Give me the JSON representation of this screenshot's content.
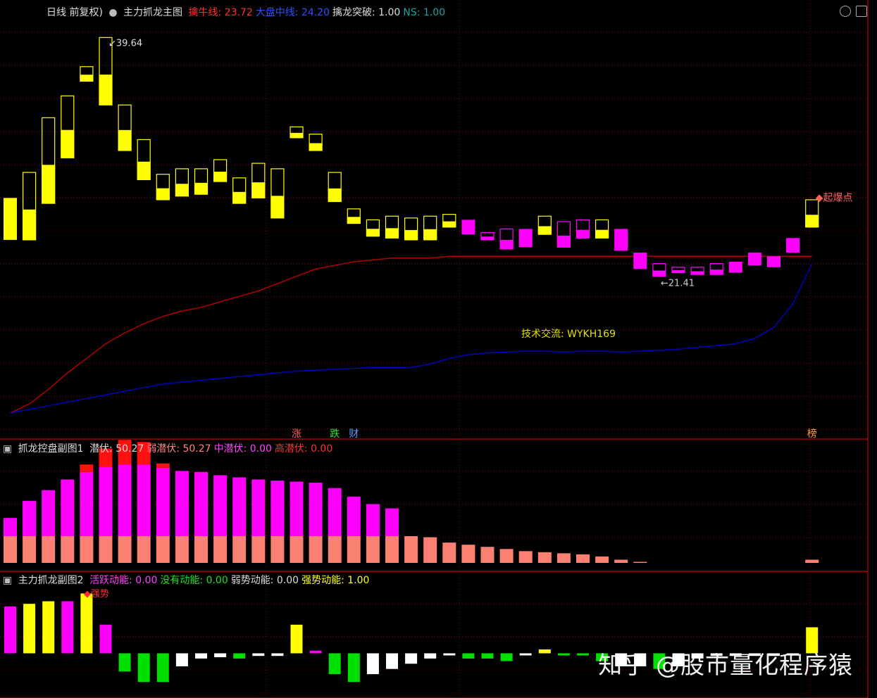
{
  "header_main": {
    "prefix": "日线 前复权)",
    "name": "主力抓龙主图",
    "items": [
      {
        "label": "擒牛线:",
        "value": "23.72",
        "color": "#ff3030"
      },
      {
        "label": "大盘中线:",
        "value": "24.20",
        "color": "#3050ff"
      },
      {
        "label": "擒龙突破:",
        "value": "1.00",
        "color": "#dddddd"
      },
      {
        "label": "NS:",
        "value": "1.00",
        "color": "#20a0a0"
      }
    ]
  },
  "header_sub1": {
    "name": "抓龙控盘副图1",
    "items": [
      {
        "label": "潜伏:",
        "value": "50.27",
        "color": "#dddddd"
      },
      {
        "label": "弱潜伏:",
        "value": "50.27",
        "color": "#ff8080"
      },
      {
        "label": "中潜伏:",
        "value": "0.00",
        "color": "#ff40ff"
      },
      {
        "label": "高潜伏:",
        "value": "0.00",
        "color": "#ff3030"
      }
    ]
  },
  "header_sub2": {
    "name": "主力抓龙副图2",
    "items": [
      {
        "label": "活跃动能:",
        "value": "0.00",
        "color": "#ff40ff"
      },
      {
        "label": "没有动能:",
        "value": "0.00",
        "color": "#20e020"
      },
      {
        "label": "弱势动能:",
        "value": "0.00",
        "color": "#dddddd"
      },
      {
        "label": "强势动能:",
        "value": "1.00",
        "color": "#ffff20"
      }
    ]
  },
  "annotations": {
    "high_label": "39.64",
    "low_label": "21.41",
    "contact": "技术交流: WYKH169",
    "signal_top": "起爆点",
    "signal_sub2": "强势",
    "markers": [
      {
        "text": "涨",
        "color": "#ff6060",
        "at": 15
      },
      {
        "text": "跌",
        "color": "#40e040",
        "at": 17
      },
      {
        "text": "财",
        "color": "#60a0ff",
        "at": 18
      },
      {
        "text": "榜",
        "color": "#ffa040",
        "at": 42
      }
    ]
  },
  "watermark": "知乎 @股市量化程序猿",
  "colors": {
    "yellow": "#ffff00",
    "magenta": "#ff00ff",
    "red_line": "#b00000",
    "blue_line": "#0000c0",
    "grid": "#8b0000",
    "salmon": "#fa8072",
    "red": "#ff1010",
    "green": "#00e000",
    "white": "#ffffff"
  },
  "chart_data": [
    {
      "type": "candlestick",
      "ylim": [
        19,
        41
      ],
      "series_candles": [
        {
          "o": 31.3,
          "c": 29.0,
          "h": 31.3,
          "l": 29.0,
          "color": "yellow",
          "fill": true
        },
        {
          "o": 29.0,
          "c": 32.7,
          "h": 32.7,
          "l": 29.0,
          "color": "yellow",
          "fill": false
        },
        {
          "o": 31.0,
          "c": 35.7,
          "h": 35.7,
          "l": 31.0,
          "color": "yellow",
          "fill": false
        },
        {
          "o": 33.5,
          "c": 36.9,
          "h": 36.9,
          "l": 33.5,
          "color": "yellow",
          "fill": false
        },
        {
          "o": 38.5,
          "c": 37.7,
          "h": 38.5,
          "l": 37.7,
          "color": "yellow",
          "fill": false
        },
        {
          "o": 40.1,
          "c": 36.4,
          "h": 40.1,
          "l": 36.4,
          "color": "yellow",
          "fill": false
        },
        {
          "o": 36.4,
          "c": 33.9,
          "h": 36.4,
          "l": 33.9,
          "color": "yellow",
          "fill": false
        },
        {
          "o": 34.5,
          "c": 32.3,
          "h": 34.5,
          "l": 32.3,
          "color": "yellow",
          "fill": false
        },
        {
          "o": 32.6,
          "c": 31.2,
          "h": 32.6,
          "l": 31.2,
          "color": "yellow",
          "fill": false
        },
        {
          "o": 32.9,
          "c": 31.4,
          "h": 32.9,
          "l": 31.4,
          "color": "yellow",
          "fill": false
        },
        {
          "o": 32.9,
          "c": 31.5,
          "h": 32.9,
          "l": 31.5,
          "color": "yellow",
          "fill": false
        },
        {
          "o": 33.4,
          "c": 32.2,
          "h": 33.4,
          "l": 32.2,
          "color": "yellow",
          "fill": false
        },
        {
          "o": 32.4,
          "c": 31.0,
          "h": 32.4,
          "l": 31.0,
          "color": "yellow",
          "fill": false
        },
        {
          "o": 33.2,
          "c": 31.3,
          "h": 33.2,
          "l": 31.3,
          "color": "yellow",
          "fill": false
        },
        {
          "o": 32.9,
          "c": 30.2,
          "h": 32.9,
          "l": 30.2,
          "color": "yellow",
          "fill": false
        },
        {
          "o": 35.2,
          "c": 34.6,
          "h": 35.2,
          "l": 34.6,
          "color": "yellow",
          "fill": false
        },
        {
          "o": 34.8,
          "c": 33.9,
          "h": 34.8,
          "l": 33.9,
          "color": "yellow",
          "fill": false
        },
        {
          "o": 32.7,
          "c": 31.1,
          "h": 32.7,
          "l": 31.1,
          "color": "yellow",
          "fill": false
        },
        {
          "o": 30.7,
          "c": 29.9,
          "h": 30.7,
          "l": 29.9,
          "color": "yellow",
          "fill": false
        },
        {
          "o": 30.1,
          "c": 29.2,
          "h": 30.1,
          "l": 29.2,
          "color": "yellow",
          "fill": false
        },
        {
          "o": 30.3,
          "c": 29.1,
          "h": 30.3,
          "l": 29.1,
          "color": "yellow",
          "fill": false
        },
        {
          "o": 30.2,
          "c": 29.0,
          "h": 30.2,
          "l": 29.0,
          "color": "yellow",
          "fill": false
        },
        {
          "o": 30.3,
          "c": 29.0,
          "h": 30.3,
          "l": 29.0,
          "color": "yellow",
          "fill": false
        },
        {
          "o": 30.4,
          "c": 29.7,
          "h": 30.4,
          "l": 29.7,
          "color": "yellow",
          "fill": false
        },
        {
          "o": 30.1,
          "c": 29.3,
          "h": 30.1,
          "l": 29.3,
          "color": "magenta",
          "fill": true
        },
        {
          "o": 29.4,
          "c": 29.0,
          "h": 29.4,
          "l": 29.0,
          "color": "magenta",
          "fill": false
        },
        {
          "o": 29.6,
          "c": 28.5,
          "h": 29.6,
          "l": 28.5,
          "color": "magenta",
          "fill": false
        },
        {
          "o": 29.6,
          "c": 28.6,
          "h": 29.6,
          "l": 28.6,
          "color": "magenta",
          "fill": true
        },
        {
          "o": 30.3,
          "c": 29.3,
          "h": 30.3,
          "l": 29.3,
          "color": "yellow",
          "fill": false
        },
        {
          "o": 30.0,
          "c": 28.6,
          "h": 30.0,
          "l": 28.6,
          "color": "magenta",
          "fill": false
        },
        {
          "o": 30.1,
          "c": 29.1,
          "h": 30.1,
          "l": 29.1,
          "color": "magenta",
          "fill": false
        },
        {
          "o": 30.1,
          "c": 29.1,
          "h": 30.1,
          "l": 29.1,
          "color": "yellow",
          "fill": false
        },
        {
          "o": 29.6,
          "c": 28.4,
          "h": 29.6,
          "l": 28.4,
          "color": "magenta",
          "fill": true
        },
        {
          "o": 28.3,
          "c": 27.4,
          "h": 28.3,
          "l": 27.4,
          "color": "magenta",
          "fill": true
        },
        {
          "o": 27.7,
          "c": 27.0,
          "h": 27.7,
          "l": 27.0,
          "color": "magenta",
          "fill": false
        },
        {
          "o": 27.5,
          "c": 27.2,
          "h": 27.5,
          "l": 27.2,
          "color": "magenta",
          "fill": false
        },
        {
          "o": 27.5,
          "c": 27.1,
          "h": 27.5,
          "l": 27.1,
          "color": "magenta",
          "fill": false
        },
        {
          "o": 27.7,
          "c": 27.1,
          "h": 27.7,
          "l": 27.1,
          "color": "magenta",
          "fill": false
        },
        {
          "o": 27.8,
          "c": 27.2,
          "h": 27.8,
          "l": 27.2,
          "color": "magenta",
          "fill": true
        },
        {
          "o": 28.3,
          "c": 27.6,
          "h": 28.3,
          "l": 27.6,
          "color": "magenta",
          "fill": true
        },
        {
          "o": 28.1,
          "c": 27.5,
          "h": 28.1,
          "l": 27.5,
          "color": "magenta",
          "fill": true
        },
        {
          "o": 29.1,
          "c": 28.3,
          "h": 29.1,
          "l": 28.3,
          "color": "magenta",
          "fill": true
        },
        {
          "o": 29.7,
          "c": 31.2,
          "h": 31.3,
          "l": 29.7,
          "color": "yellow",
          "fill": false
        }
      ],
      "red_line": [
        19.5,
        20.0,
        20.8,
        21.7,
        22.5,
        23.3,
        23.9,
        24.4,
        24.8,
        25.1,
        25.3,
        25.6,
        25.9,
        26.2,
        26.6,
        27.0,
        27.4,
        27.6,
        27.8,
        27.9,
        28.0,
        28.0,
        28.0,
        28.1,
        28.1,
        28.1,
        28.1,
        28.1,
        28.1,
        28.1,
        28.1,
        28.1,
        28.1,
        28.1,
        28.1,
        28.1,
        28.1,
        28.1,
        28.1,
        28.1,
        28.1,
        28.1,
        28.1
      ],
      "blue_line": [
        19.5,
        19.7,
        19.9,
        20.1,
        20.3,
        20.5,
        20.7,
        20.9,
        21.1,
        21.2,
        21.3,
        21.4,
        21.5,
        21.6,
        21.7,
        21.8,
        21.85,
        21.9,
        21.95,
        22.0,
        22.0,
        22.0,
        22.2,
        22.5,
        22.7,
        22.8,
        22.85,
        22.9,
        22.9,
        22.85,
        22.9,
        22.9,
        22.85,
        22.9,
        22.95,
        23.0,
        23.1,
        23.2,
        23.3,
        23.6,
        24.2,
        25.5,
        27.7
      ]
    },
    {
      "type": "bar",
      "stacked": true,
      "ylim": [
        0,
        100
      ],
      "series": [
        {
          "color": "salmon",
          "values": [
            25,
            25,
            25,
            25,
            25,
            25,
            25,
            25,
            25,
            25,
            25,
            25,
            25,
            25,
            25,
            25,
            25,
            25,
            25,
            25,
            25,
            25,
            24,
            19,
            17,
            15,
            13,
            11,
            10,
            9,
            8,
            6,
            3,
            1,
            0,
            0,
            0,
            0,
            0,
            0,
            0,
            0,
            3
          ]
        },
        {
          "color": "magenta",
          "values": [
            17,
            33,
            43,
            53,
            60,
            65,
            67,
            67,
            64,
            61,
            60,
            57,
            55,
            53,
            52,
            51,
            50,
            45,
            37,
            30,
            26,
            0,
            0,
            0,
            0,
            0,
            0,
            0,
            0,
            0,
            0,
            0,
            0,
            0,
            0,
            0,
            0,
            0,
            0,
            0,
            0,
            0,
            0
          ]
        },
        {
          "color": "red",
          "values": [
            0,
            0,
            0,
            0,
            7,
            17,
            23,
            21,
            4,
            0,
            0,
            0,
            0,
            0,
            0,
            0,
            0,
            0,
            0,
            0,
            0,
            0,
            0,
            0,
            0,
            0,
            0,
            0,
            0,
            0,
            0,
            0,
            0,
            0,
            0,
            0,
            0,
            0,
            0,
            0,
            0,
            0,
            0
          ]
        }
      ]
    },
    {
      "type": "bar",
      "ylim": [
        -15,
        25
      ],
      "bars": [
        {
          "v": 18,
          "c": "magenta"
        },
        {
          "v": 19,
          "c": "yellow"
        },
        {
          "v": 20,
          "c": "yellow"
        },
        {
          "v": 20,
          "c": "magenta"
        },
        {
          "v": 23,
          "c": "yellow"
        },
        {
          "v": 11,
          "c": "magenta"
        },
        {
          "v": -7,
          "c": "green"
        },
        {
          "v": -11,
          "c": "green"
        },
        {
          "v": -11,
          "c": "green"
        },
        {
          "v": -5,
          "c": "white"
        },
        {
          "v": -2,
          "c": "white"
        },
        {
          "v": -1.5,
          "c": "white"
        },
        {
          "v": -2,
          "c": "green"
        },
        {
          "v": -1,
          "c": "white"
        },
        {
          "v": -1,
          "c": "white"
        },
        {
          "v": 11,
          "c": "yellow"
        },
        {
          "v": 1,
          "c": "magenta"
        },
        {
          "v": -8,
          "c": "green"
        },
        {
          "v": -11,
          "c": "green"
        },
        {
          "v": -8,
          "c": "white"
        },
        {
          "v": -6,
          "c": "white"
        },
        {
          "v": -4,
          "c": "white"
        },
        {
          "v": -2,
          "c": "white"
        },
        {
          "v": -0.5,
          "c": "white"
        },
        {
          "v": -2,
          "c": "green"
        },
        {
          "v": -2,
          "c": "green"
        },
        {
          "v": -3,
          "c": "green"
        },
        {
          "v": -0.5,
          "c": "white"
        },
        {
          "v": 1.5,
          "c": "yellow"
        },
        {
          "v": -0.5,
          "c": "green"
        },
        {
          "v": -0.5,
          "c": "green"
        },
        {
          "v": -3,
          "c": "green"
        },
        {
          "v": -5,
          "c": "white"
        },
        {
          "v": -5,
          "c": "white"
        },
        {
          "v": -6,
          "c": "green"
        },
        {
          "v": -5,
          "c": "white"
        },
        {
          "v": -2,
          "c": "white"
        },
        {
          "v": -1,
          "c": "white"
        },
        {
          "v": -1,
          "c": "white"
        },
        {
          "v": -1,
          "c": "white"
        },
        {
          "v": -1,
          "c": "white"
        },
        {
          "v": 0,
          "c": "white"
        },
        {
          "v": 10,
          "c": "yellow"
        }
      ]
    }
  ]
}
